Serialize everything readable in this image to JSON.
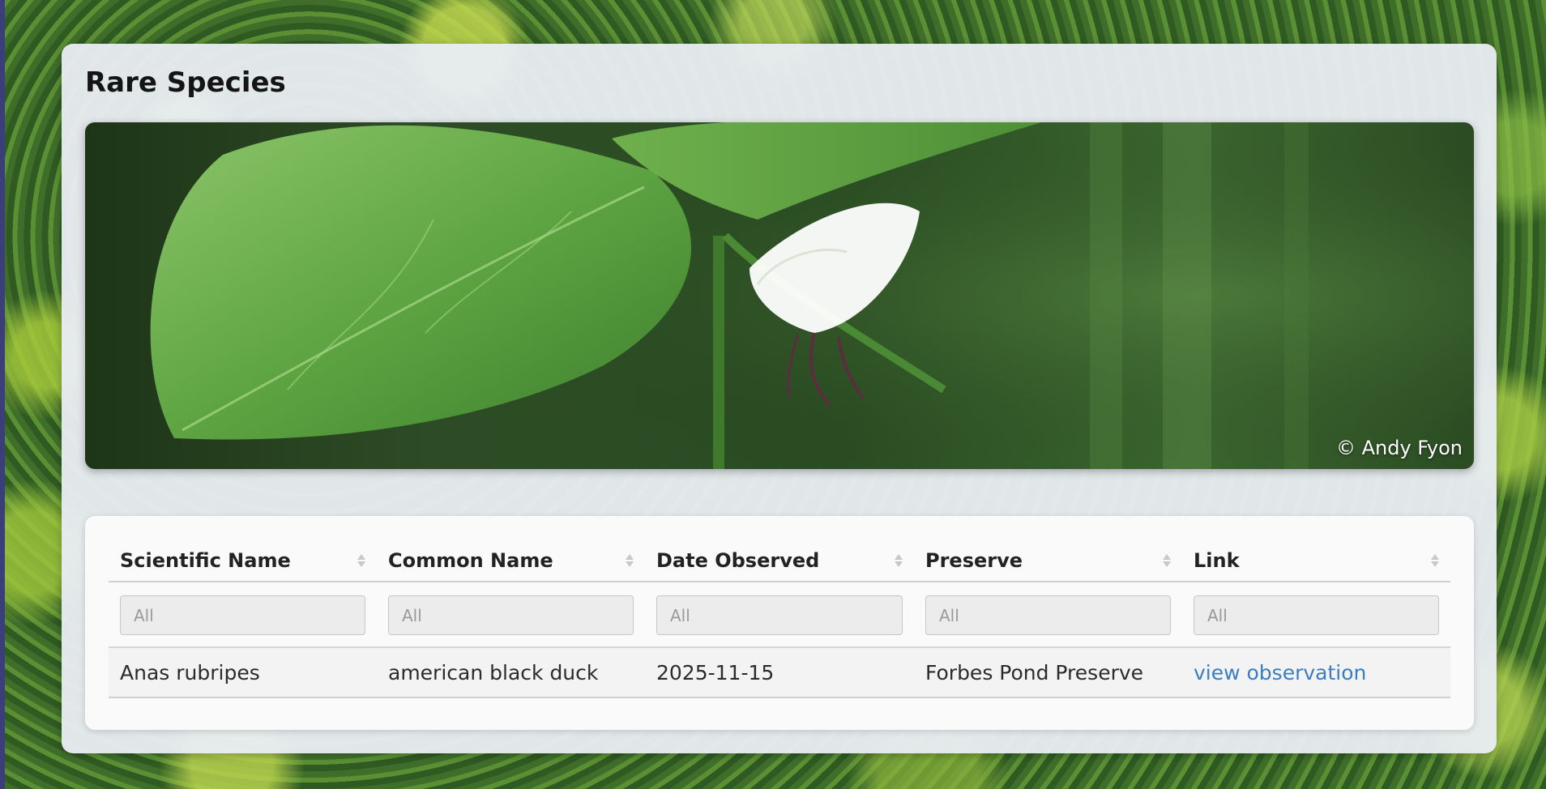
{
  "page": {
    "title": "Rare Species"
  },
  "hero": {
    "image_description": "close-up of a white flowering plant with broad green leaves",
    "credit": "© Andy Fyon"
  },
  "table": {
    "columns": [
      {
        "label": "Scientific Name",
        "filter_placeholder": "All"
      },
      {
        "label": "Common Name",
        "filter_placeholder": "All"
      },
      {
        "label": "Date Observed",
        "filter_placeholder": "All"
      },
      {
        "label": "Preserve",
        "filter_placeholder": "All"
      },
      {
        "label": "Link",
        "filter_placeholder": "All"
      }
    ],
    "rows": [
      {
        "scientific_name": "Anas rubripes",
        "common_name": "american black duck",
        "date_observed": "2025-11-15",
        "preserve": "Forbes Pond Preserve",
        "link_label": "view observation"
      }
    ]
  },
  "colors": {
    "link": "#3a7ebf",
    "panel_bg": "#e8ecf1",
    "heading": "#141414"
  }
}
